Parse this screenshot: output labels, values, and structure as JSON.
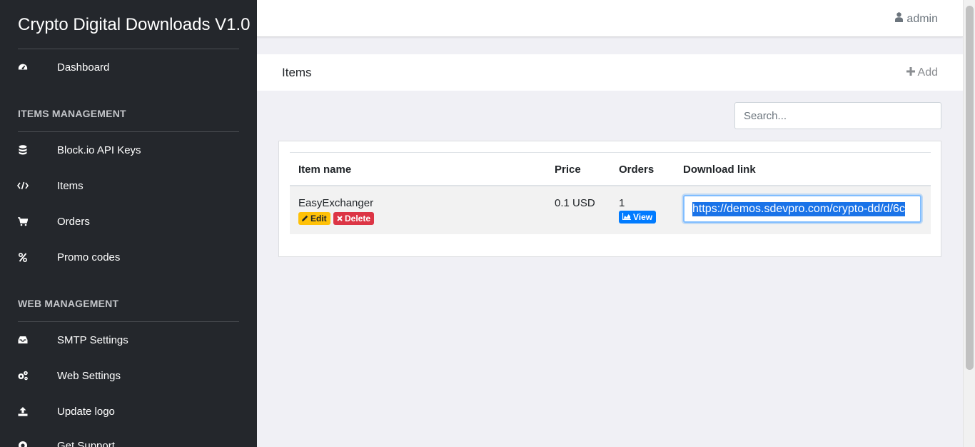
{
  "app": {
    "title": "Crypto Digital Downloads V1.0"
  },
  "sidebar": {
    "dashboard": {
      "label": "Dashboard",
      "icon": "dashboard-icon"
    },
    "sections": [
      {
        "title": "ITEMS MANAGEMENT",
        "items": [
          {
            "label": "Block.io API Keys",
            "icon": "database-icon"
          },
          {
            "label": "Items",
            "icon": "code-icon"
          },
          {
            "label": "Orders",
            "icon": "cart-icon"
          },
          {
            "label": "Promo codes",
            "icon": "percent-icon"
          }
        ]
      },
      {
        "title": "WEB MANAGEMENT",
        "items": [
          {
            "label": "SMTP Settings",
            "icon": "inbox-icon"
          },
          {
            "label": "Web Settings",
            "icon": "gears-icon"
          },
          {
            "label": "Update logo",
            "icon": "upload-icon"
          },
          {
            "label": "Get Support",
            "icon": "support-icon"
          }
        ]
      }
    ]
  },
  "topbar": {
    "user": "admin",
    "user_icon": "user-icon"
  },
  "page": {
    "title": "Items",
    "add_label": "Add",
    "search_placeholder": "Search..."
  },
  "table": {
    "columns": [
      "Item name",
      "Price",
      "Orders",
      "Download link"
    ],
    "rows": [
      {
        "name": "EasyExchanger",
        "edit_label": "Edit",
        "delete_label": "Delete",
        "price": "0.1 USD",
        "orders": "1",
        "view_label": "View",
        "download_link": "https://demos.sdevpro.com/crypto-dd/d/6c"
      }
    ]
  },
  "colors": {
    "sidebar_bg": "#24272c",
    "edit": "#ffc107",
    "delete": "#dc3545",
    "view": "#007bff",
    "selection": "#1a73e8"
  }
}
